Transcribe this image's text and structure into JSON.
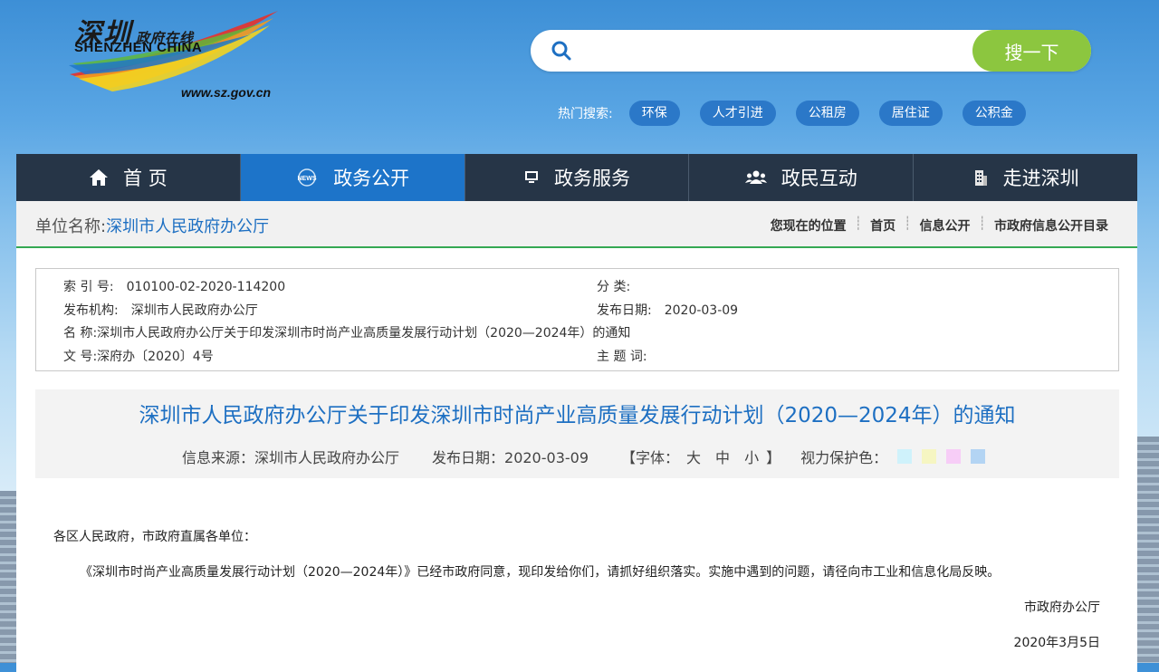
{
  "header": {
    "logo_cn": "深圳",
    "logo_cn_small": "政府在线",
    "logo_en": "SHENZHEN CHINA",
    "logo_url": "www.sz.gov.cn",
    "search_placeholder": "",
    "search_button": "搜一下",
    "hot_label": "热门搜索:",
    "hot_tags": [
      "环保",
      "人才引进",
      "公租房",
      "居住证",
      "公积金"
    ]
  },
  "nav": [
    {
      "label": "首 页",
      "icon": "home-icon"
    },
    {
      "label": "政务公开",
      "icon": "news-icon",
      "active": true
    },
    {
      "label": "政务服务",
      "icon": "monitor-icon"
    },
    {
      "label": "政民互动",
      "icon": "people-icon"
    },
    {
      "label": "走进深圳",
      "icon": "building-icon"
    }
  ],
  "unit": {
    "label": "单位名称:",
    "name": "深圳市人民政府办公厅"
  },
  "breadcrumb": [
    "您现在的位置",
    "首页",
    "信息公开",
    "市政府信息公开目录"
  ],
  "meta": {
    "index_label": "索 引 号:",
    "index_value": "010100-02-2020-114200",
    "category_label": "分 类:",
    "category_value": "",
    "org_label": "发布机构:",
    "org_value": "深圳市人民政府办公厅",
    "date_label": "发布日期:",
    "date_value": "2020-03-09",
    "name_label": "名 称:",
    "name_value": "深圳市人民政府办公厅关于印发深圳市时尚产业高质量发展行动计划（2020—2024年）的通知",
    "docno_label": "文 号:",
    "docno_value": "深府办〔2020〕4号",
    "topic_label": "主 题 词:",
    "topic_value": ""
  },
  "document": {
    "title": "深圳市人民政府办公厅关于印发深圳市时尚产业高质量发展行动计划（2020—2024年）的通知",
    "source": "信息来源：深圳市人民政府办公厅",
    "pubdate": "发布日期：2020-03-09",
    "font_label": "【字体：",
    "font_large": "大",
    "font_medium": "中",
    "font_small": "小",
    "font_close": "】",
    "eye_label": "视力保护色：",
    "eye_colors": [
      "#cff2fb",
      "#f6f6c2",
      "#f7cdf7",
      "#b3d4f3"
    ],
    "salutation": "各区人民政府，市政府直属各单位：",
    "paragraph": "《深圳市时尚产业高质量发展行动计划（2020—2024年）》已经市政府同意，现印发给你们，请抓好组织落实。实施中遇到的问题，请径向市工业和信息化局反映。",
    "signature": "市政府办公厅",
    "sign_date": "2020年3月5日"
  },
  "colors": {
    "nav_bg": "#263547",
    "nav_active": "#1d74c9",
    "search_button": "#8cc63f",
    "hot_tag": "#2b78c8",
    "title_blue": "#1d6fc2",
    "divider_green": "#34a853"
  }
}
